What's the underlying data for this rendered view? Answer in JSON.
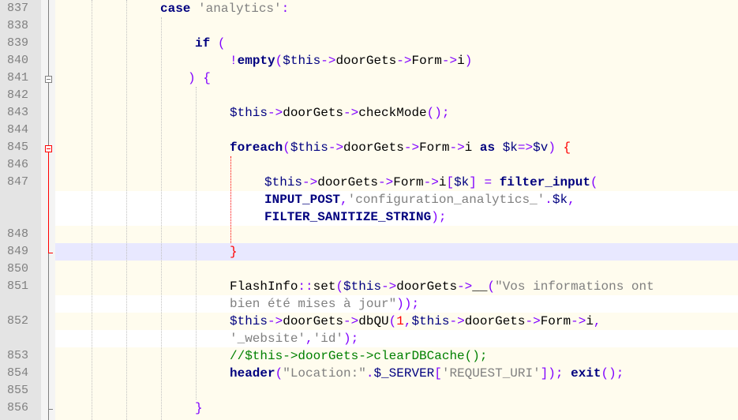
{
  "editor": {
    "lines": [
      {
        "num": "837",
        "tokens": [
          [
            "kw",
            "case"
          ],
          [
            "plain",
            " "
          ],
          [
            "str",
            "'analytics'"
          ],
          [
            "op",
            ":"
          ]
        ]
      },
      {
        "num": "838",
        "tokens": []
      },
      {
        "num": "839",
        "tokens": [
          [
            "kw",
            "if"
          ],
          [
            "plain",
            " "
          ],
          [
            "op",
            "("
          ]
        ]
      },
      {
        "num": "840",
        "tokens": [
          [
            "op",
            "!"
          ],
          [
            "kw",
            "empty"
          ],
          [
            "op",
            "("
          ],
          [
            "var",
            "$this"
          ],
          [
            "op",
            "->"
          ],
          [
            "plain",
            "doorGets"
          ],
          [
            "op",
            "->"
          ],
          [
            "plain",
            "Form"
          ],
          [
            "op",
            "->"
          ],
          [
            "plain",
            "i"
          ],
          [
            "op",
            ")"
          ]
        ]
      },
      {
        "num": "841",
        "tokens": [
          [
            "op",
            ")"
          ],
          [
            "plain",
            " "
          ],
          [
            "op",
            "{"
          ]
        ]
      },
      {
        "num": "842",
        "tokens": []
      },
      {
        "num": "843",
        "tokens": [
          [
            "var",
            "$this"
          ],
          [
            "op",
            "->"
          ],
          [
            "plain",
            "doorGets"
          ],
          [
            "op",
            "->"
          ],
          [
            "plain",
            "checkMode"
          ],
          [
            "op",
            "();"
          ]
        ]
      },
      {
        "num": "844",
        "tokens": []
      },
      {
        "num": "845",
        "tokens": [
          [
            "kw",
            "foreach"
          ],
          [
            "op",
            "("
          ],
          [
            "var",
            "$this"
          ],
          [
            "op",
            "->"
          ],
          [
            "plain",
            "doorGets"
          ],
          [
            "op",
            "->"
          ],
          [
            "plain",
            "Form"
          ],
          [
            "op",
            "->"
          ],
          [
            "plain",
            "i"
          ],
          [
            "plain",
            " "
          ],
          [
            "kw",
            "as"
          ],
          [
            "plain",
            " "
          ],
          [
            "var",
            "$k"
          ],
          [
            "op",
            "=>"
          ],
          [
            "var",
            "$v"
          ],
          [
            "op",
            ")"
          ],
          [
            "plain",
            " "
          ],
          [
            "red",
            "{"
          ]
        ]
      },
      {
        "num": "846",
        "tokens": []
      },
      {
        "num": "847",
        "tokens": [
          [
            "var",
            "$this"
          ],
          [
            "op",
            "->"
          ],
          [
            "plain",
            "doorGets"
          ],
          [
            "op",
            "->"
          ],
          [
            "plain",
            "Form"
          ],
          [
            "op",
            "->"
          ],
          [
            "plain",
            "i"
          ],
          [
            "op",
            "["
          ],
          [
            "var",
            "$k"
          ],
          [
            "op",
            "]"
          ],
          [
            "plain",
            " "
          ],
          [
            "op",
            "="
          ],
          [
            "plain",
            " "
          ],
          [
            "kw",
            "filter_input"
          ],
          [
            "op",
            "("
          ]
        ]
      },
      {
        "num": "",
        "tokens": [
          [
            "kw",
            "INPUT_POST"
          ],
          [
            "op",
            ","
          ],
          [
            "str",
            "'configuration_analytics_'"
          ],
          [
            "op",
            "."
          ],
          [
            "var",
            "$k"
          ],
          [
            "op",
            ","
          ]
        ]
      },
      {
        "num": "",
        "tokens": [
          [
            "kw",
            "FILTER_SANITIZE_STRING"
          ],
          [
            "op",
            ");"
          ]
        ]
      },
      {
        "num": "848",
        "tokens": []
      },
      {
        "num": "849",
        "tokens": [
          [
            "red",
            "}"
          ]
        ]
      },
      {
        "num": "850",
        "tokens": []
      },
      {
        "num": "851",
        "tokens": [
          [
            "plain",
            "FlashInfo"
          ],
          [
            "op",
            "::"
          ],
          [
            "plain",
            "set"
          ],
          [
            "op",
            "("
          ],
          [
            "var",
            "$this"
          ],
          [
            "op",
            "->"
          ],
          [
            "plain",
            "doorGets"
          ],
          [
            "op",
            "->"
          ],
          [
            "plain",
            "__"
          ],
          [
            "op",
            "("
          ],
          [
            "str",
            "\"Vos informations ont"
          ]
        ]
      },
      {
        "num": "",
        "tokens": [
          [
            "str",
            "bien été mises à jour\""
          ],
          [
            "op",
            "));"
          ]
        ]
      },
      {
        "num": "852",
        "tokens": [
          [
            "var",
            "$this"
          ],
          [
            "op",
            "->"
          ],
          [
            "plain",
            "doorGets"
          ],
          [
            "op",
            "->"
          ],
          [
            "plain",
            "dbQU"
          ],
          [
            "op",
            "("
          ],
          [
            "num",
            "1"
          ],
          [
            "op",
            ","
          ],
          [
            "var",
            "$this"
          ],
          [
            "op",
            "->"
          ],
          [
            "plain",
            "doorGets"
          ],
          [
            "op",
            "->"
          ],
          [
            "plain",
            "Form"
          ],
          [
            "op",
            "->"
          ],
          [
            "plain",
            "i"
          ],
          [
            "op",
            ","
          ]
        ]
      },
      {
        "num": "",
        "tokens": [
          [
            "str",
            "'_website'"
          ],
          [
            "op",
            ","
          ],
          [
            "str",
            "'id'"
          ],
          [
            "op",
            ");"
          ]
        ]
      },
      {
        "num": "853",
        "tokens": [
          [
            "cmt",
            "//$this->doorGets->clearDBCache();"
          ]
        ]
      },
      {
        "num": "854",
        "tokens": [
          [
            "kw",
            "header"
          ],
          [
            "op",
            "("
          ],
          [
            "str",
            "\"Location:\""
          ],
          [
            "op",
            "."
          ],
          [
            "var",
            "$_SERVER"
          ],
          [
            "op",
            "["
          ],
          [
            "str",
            "'REQUEST_URI'"
          ],
          [
            "op",
            "]);"
          ],
          [
            "plain",
            " "
          ],
          [
            "kw",
            "exit"
          ],
          [
            "op",
            "();"
          ]
        ]
      },
      {
        "num": "855",
        "tokens": []
      },
      {
        "num": "856",
        "tokens": [
          [
            "op",
            "}"
          ]
        ]
      }
    ]
  }
}
